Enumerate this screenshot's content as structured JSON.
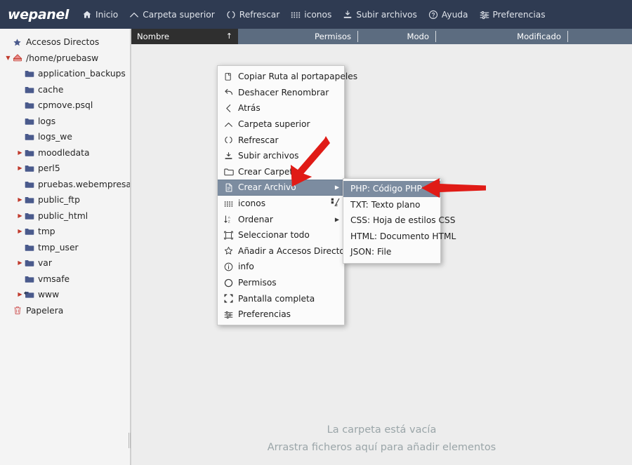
{
  "topbar": {
    "brand": "wepanel",
    "items": [
      {
        "label": "Inicio",
        "icon": "home-icon"
      },
      {
        "label": "Carpeta superior",
        "icon": "chevron-up-icon"
      },
      {
        "label": "Refrescar",
        "icon": "refresh-icon"
      },
      {
        "label": "iconos",
        "icon": "grid-icon"
      },
      {
        "label": "Subir archivos",
        "icon": "upload-icon"
      },
      {
        "label": "Ayuda",
        "icon": "help-circle-icon"
      },
      {
        "label": "Preferencias",
        "icon": "sliders-icon"
      }
    ]
  },
  "sidebar": {
    "items": [
      {
        "label": "Accesos Directos",
        "icon": "star-icon",
        "level": 1,
        "twisty": "",
        "color": "#4a5a8c"
      },
      {
        "label": "/home/pruebasw",
        "icon": "home-disk-icon",
        "level": 1,
        "twisty": "down",
        "color": "#c0392b"
      },
      {
        "label": "application_backups",
        "icon": "folder-icon",
        "level": 2,
        "twisty": ""
      },
      {
        "label": "cache",
        "icon": "folder-icon",
        "level": 2,
        "twisty": ""
      },
      {
        "label": "cpmove.psql",
        "icon": "folder-icon",
        "level": 2,
        "twisty": ""
      },
      {
        "label": "logs",
        "icon": "folder-icon",
        "level": 2,
        "twisty": ""
      },
      {
        "label": "logs_we",
        "icon": "folder-icon",
        "level": 2,
        "twisty": ""
      },
      {
        "label": "moodledata",
        "icon": "folder-icon",
        "level": 2,
        "twisty": "right"
      },
      {
        "label": "perl5",
        "icon": "folder-icon",
        "level": 2,
        "twisty": "right"
      },
      {
        "label": "pruebas.webempresa.eu",
        "icon": "folder-icon",
        "level": 2,
        "twisty": ""
      },
      {
        "label": "public_ftp",
        "icon": "folder-icon",
        "level": 2,
        "twisty": "right"
      },
      {
        "label": "public_html",
        "icon": "folder-icon",
        "level": 2,
        "twisty": "right"
      },
      {
        "label": "tmp",
        "icon": "folder-icon",
        "level": 2,
        "twisty": "right"
      },
      {
        "label": "tmp_user",
        "icon": "folder-icon",
        "level": 2,
        "twisty": ""
      },
      {
        "label": "var",
        "icon": "folder-icon",
        "level": 2,
        "twisty": "right"
      },
      {
        "label": "vmsafe",
        "icon": "folder-icon",
        "level": 2,
        "twisty": ""
      },
      {
        "label": "www",
        "icon": "folder-link-icon",
        "level": 2,
        "twisty": "right"
      },
      {
        "label": "Papelera",
        "icon": "trash-icon",
        "level": 1,
        "twisty": "",
        "color": "#c0392b"
      }
    ]
  },
  "columns": [
    {
      "label": "Nombre",
      "sort": "↑"
    },
    {
      "label": "Permisos"
    },
    {
      "label": "Modo"
    },
    {
      "label": "Modificado"
    }
  ],
  "empty_state": {
    "line1": "La carpeta está vacía",
    "line2": "Arrastra ficheros aquí para añadir elementos"
  },
  "context_menu": {
    "items": [
      {
        "label": "Copiar Ruta al portapapeles",
        "icon": "copy-icon"
      },
      {
        "label": "Deshacer Renombrar",
        "icon": "undo-icon"
      },
      {
        "label": "Atrás",
        "icon": "chevron-left-icon"
      },
      {
        "label": "Carpeta superior",
        "icon": "chevron-up-icon"
      },
      {
        "label": "Refrescar",
        "icon": "refresh-icon"
      },
      {
        "label": "Subir archivos",
        "icon": "upload-icon"
      },
      {
        "label": "Crear Carpeta",
        "icon": "folder-outline-icon"
      },
      {
        "label": "Crear Archivo",
        "icon": "file-icon",
        "selected": true,
        "submenu": true
      },
      {
        "label": "iconos",
        "icon": "grid-icon",
        "right_icon": "view-toggle-icon"
      },
      {
        "label": "Ordenar",
        "icon": "sort-icon",
        "submenu": true
      },
      {
        "label": "Seleccionar todo",
        "icon": "select-all-icon"
      },
      {
        "label": "Añadir a Accesos Directos",
        "icon": "star-outline-icon"
      },
      {
        "label": "info",
        "icon": "info-icon"
      },
      {
        "label": "Permisos",
        "icon": "circle-icon"
      },
      {
        "label": "Pantalla completa",
        "icon": "fullscreen-icon"
      },
      {
        "label": "Preferencias",
        "icon": "sliders-icon"
      }
    ]
  },
  "submenu": {
    "items": [
      {
        "label": "PHP: Código PHP",
        "selected": true
      },
      {
        "label": "TXT: Texto plano",
        "selected": false
      },
      {
        "label": "CSS: Hoja de estilos CSS",
        "selected": false
      },
      {
        "label": "HTML: Documento HTML",
        "selected": false
      },
      {
        "label": "JSON: File",
        "selected": false
      }
    ]
  },
  "annotations": [
    {
      "name": "arrow-to-crear-archivo",
      "color": "#e01b16"
    },
    {
      "name": "arrow-to-php-option",
      "color": "#e01b16"
    }
  ],
  "colors": {
    "topbar_bg": "#2f3b52",
    "sidebar_bg": "#f4f4f4",
    "column_header_bg": "#5c6c80",
    "name_column_bg": "#2f2f2f",
    "menu_highlight": "#7c8ca0",
    "annotation_red": "#e01b16",
    "empty_text": "#9aa5a8"
  }
}
